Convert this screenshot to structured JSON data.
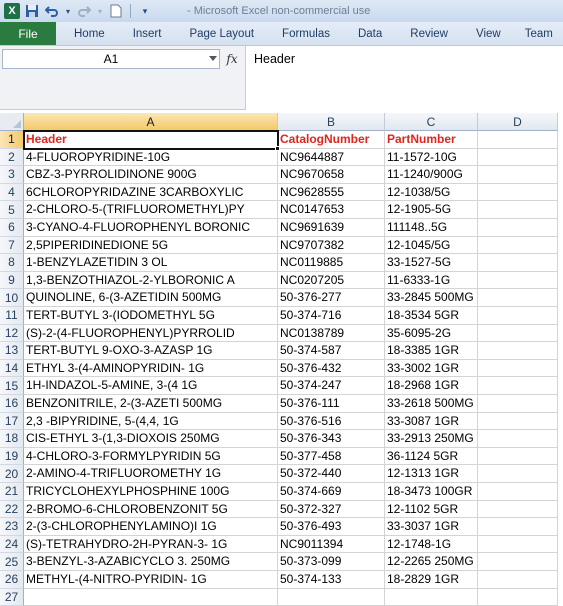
{
  "window": {
    "title": "- Microsoft Excel non-commercial use",
    "quick_access": [
      "excel-logo-icon",
      "save-icon",
      "undo-icon",
      "redo-icon",
      "new-document-icon",
      "customize-qat-icon"
    ]
  },
  "ribbon": {
    "file_label": "File",
    "tabs": [
      "Home",
      "Insert",
      "Page Layout",
      "Formulas",
      "Data",
      "Review",
      "View",
      "Team"
    ]
  },
  "formula_bar": {
    "name_box": "A1",
    "fx_label": "fx",
    "content": "Header"
  },
  "sheet": {
    "columns": [
      "A",
      "B",
      "C",
      "D"
    ],
    "selected_column": "A",
    "selected_row": 1,
    "rows": [
      {
        "num": "1",
        "a": "Header",
        "b": "CatalogNumber",
        "c": "PartNumber"
      },
      {
        "num": "2",
        "a": "4-FLUOROPYRIDINE-10G",
        "b": "NC9644887",
        "c": "11-1572-10G"
      },
      {
        "num": "3",
        "a": "CBZ-3-PYRROLIDINONE 900G",
        "b": "NC9670658",
        "c": "11-1240/900G"
      },
      {
        "num": "4",
        "a": "6CHLOROPYRIDAZINE 3CARBOXYLIC",
        "b": "NC9628555",
        "c": "12-1038/5G"
      },
      {
        "num": "5",
        "a": "2-CHLORO-5-(TRIFLUOROMETHYL)PY",
        "b": "NC0147653",
        "c": "12-1905-5G"
      },
      {
        "num": "6",
        "a": "3-CYANO-4-FLUOROPHENYL BORONIC",
        "b": "NC9691639",
        "c": "111148..5G"
      },
      {
        "num": "7",
        "a": "2,5PIPERIDINEDIONE 5G",
        "b": "NC9707382",
        "c": "12-1045/5G"
      },
      {
        "num": "8",
        "a": "1-BENZYLAZETIDIN 3 OL",
        "b": "NC0119885",
        "c": "33-1527-5G"
      },
      {
        "num": "9",
        "a": "1,3-BENZOTHIAZOL-2-YLBORONIC A",
        "b": "NC0207205",
        "c": "11-6333-1G"
      },
      {
        "num": "10",
        "a": "QUINOLINE, 6-(3-AZETIDIN 500MG",
        "b": "50-376-277",
        "c": "33-2845 500MG"
      },
      {
        "num": "11",
        "a": "TERT-BUTYL 3-(IODOMETHYL 5G",
        "b": "50-374-716",
        "c": "18-3534 5GR"
      },
      {
        "num": "12",
        "a": "(S)-2-(4-FLUOROPHENYL)PYRROLID",
        "b": "NC0138789",
        "c": "35-6095-2G"
      },
      {
        "num": "13",
        "a": "TERT-BUTYL 9-OXO-3-AZASP 1G",
        "b": "50-374-587",
        "c": "18-3385 1GR"
      },
      {
        "num": "14",
        "a": "ETHYL 3-(4-AMINOPYRIDIN- 1G",
        "b": "50-376-432",
        "c": "33-3002 1GR"
      },
      {
        "num": "15",
        "a": "1H-INDAZOL-5-AMINE, 3-(4 1G",
        "b": "50-374-247",
        "c": "18-2968 1GR"
      },
      {
        "num": "16",
        "a": "BENZONITRILE, 2-(3-AZETI 500MG",
        "b": "50-376-111",
        "c": "33-2618 500MG"
      },
      {
        "num": "17",
        "a": "2,3 -BIPYRIDINE, 5-(4,4, 1G",
        "b": "50-376-516",
        "c": "33-3087 1GR"
      },
      {
        "num": "18",
        "a": "CIS-ETHYL 3-(1,3-DIOXOIS 250MG",
        "b": "50-376-343",
        "c": "33-2913 250MG"
      },
      {
        "num": "19",
        "a": "4-CHLORO-3-FORMYLPYRIDIN 5G",
        "b": "50-377-458",
        "c": "36-1124 5GR"
      },
      {
        "num": "20",
        "a": "2-AMINO-4-TRIFLUOROMETHY 1G",
        "b": "50-372-440",
        "c": "12-1313 1GR"
      },
      {
        "num": "21",
        "a": "TRICYCLOHEXYLPHOSPHINE 100G",
        "b": "50-374-669",
        "c": "18-3473 100GR"
      },
      {
        "num": "22",
        "a": "2-BROMO-6-CHLOROBENZONIT 5G",
        "b": "50-372-327",
        "c": "12-1102 5GR"
      },
      {
        "num": "23",
        "a": "2-(3-CHLOROPHENYLAMINO)I 1G",
        "b": "50-376-493",
        "c": "33-3037 1GR"
      },
      {
        "num": "24",
        "a": "(S)-TETRAHYDRO-2H-PYRAN-3- 1G",
        "b": "NC9011394",
        "c": "12-1748-1G"
      },
      {
        "num": "25",
        "a": "3-BENZYL-3-AZABICYCLO 3. 250MG",
        "b": "50-373-099",
        "c": "12-2265 250MG"
      },
      {
        "num": "26",
        "a": "METHYL-(4-NITRO-PYRIDIN- 1G",
        "b": "50-374-133",
        "c": "18-2829 1GR"
      },
      {
        "num": "27",
        "a": "",
        "b": "",
        "c": ""
      }
    ]
  }
}
